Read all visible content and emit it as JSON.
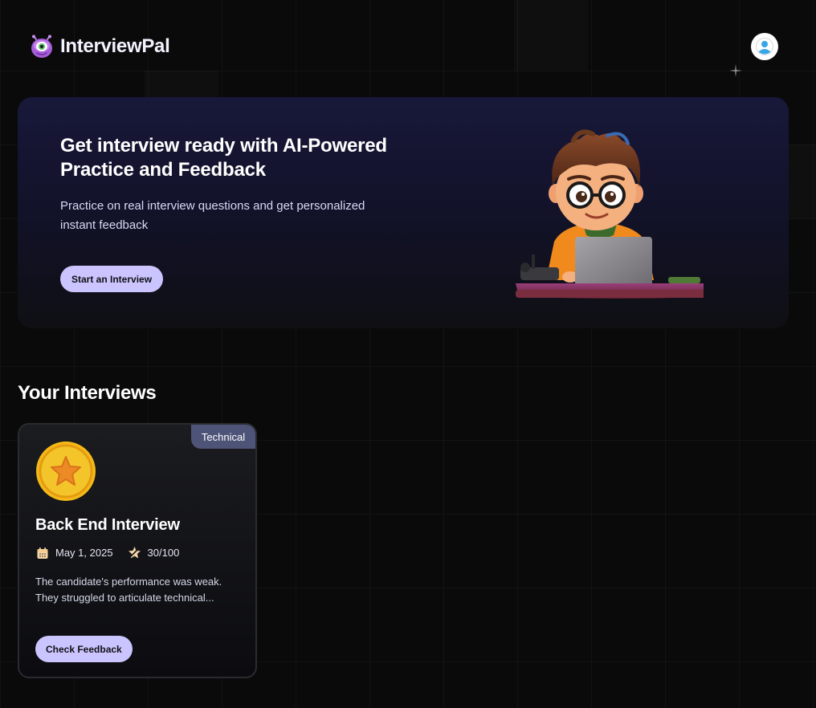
{
  "brand": {
    "name": "InterviewPal",
    "logo_icon": "alien-mascot-icon"
  },
  "user": {
    "avatar_icon": "user-icon"
  },
  "hero": {
    "title": "Get interview ready with AI-Powered Practice and Feedback",
    "subtitle": "Practice on real interview questions and get personalized instant feedback",
    "cta_label": "Start an Interview",
    "illustration": "developer-at-laptop-illustration"
  },
  "section": {
    "title": "Your Interviews"
  },
  "interviews": [
    {
      "type": "Technical",
      "title": "Back End Interview",
      "date": "May 1, 2025",
      "score": "30/100",
      "description": "The candidate's performance was weak. They struggled to articulate technical...",
      "action_label": "Check Feedback",
      "cover_icon": "star-medal-icon"
    }
  ],
  "colors": {
    "accent": "#cac5fe",
    "badge": "#4e5478",
    "background": "#0a0a0b",
    "hero_top": "#18183a"
  }
}
